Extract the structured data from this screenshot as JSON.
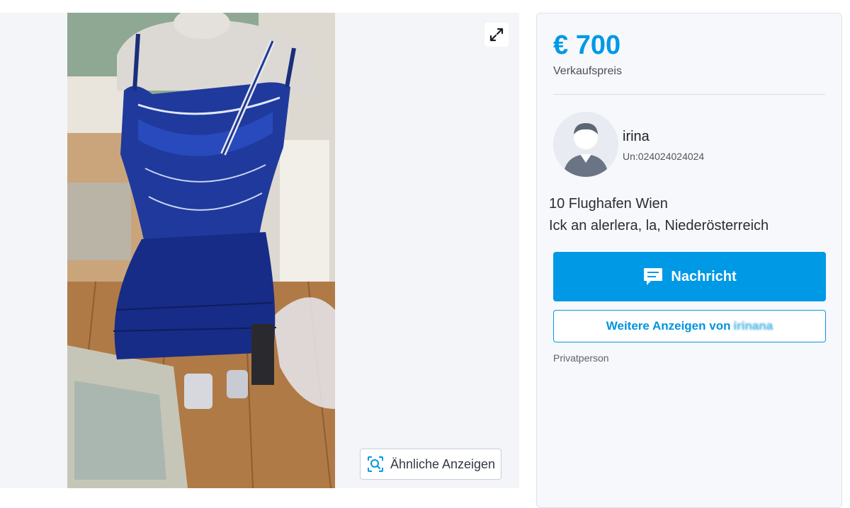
{
  "gallery": {
    "photo_alt": "Blue sequined fringe dress on mannequin",
    "expand_icon": "expand-arrows-icon",
    "similar_ads_label": "Ähnliche Anzeigen",
    "similar_ads_icon": "image-search-icon"
  },
  "listing": {
    "price": "€ 700",
    "price_label": "Verkaufspreis"
  },
  "seller": {
    "avatar_icon": "user-avatar-icon",
    "name": "irina",
    "member_since": "Un:024024024024",
    "location_line1": "10 Flughafen Wien",
    "location_line2": "Ick an alerlera, la, Niederösterreich",
    "type": "Privatperson"
  },
  "actions": {
    "message_label": "Nachricht",
    "message_icon": "chat-bubble-icon",
    "more_ads_label": "Weitere Anzeigen von",
    "more_ads_name": "irinana"
  },
  "colors": {
    "accent": "#0099e5",
    "sidebar_bg": "#f6f8fc",
    "gallery_bg": "#f4f5f8"
  }
}
